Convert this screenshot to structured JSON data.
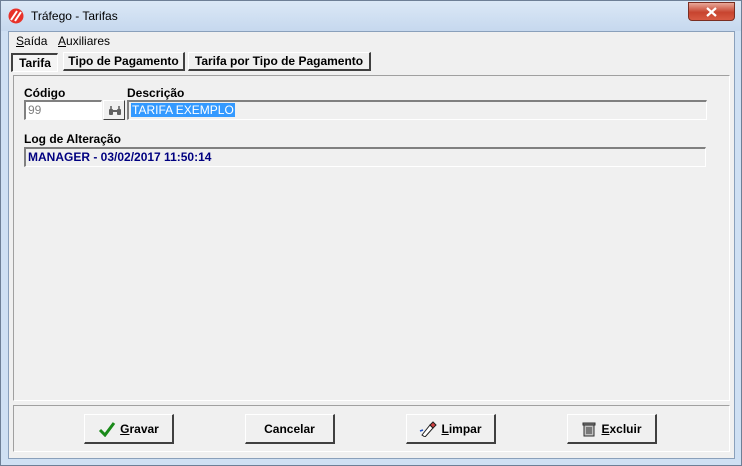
{
  "window": {
    "title": "Tráfego - Tarifas"
  },
  "menu": {
    "items": [
      {
        "first": "S",
        "rest": "aída"
      },
      {
        "first": "A",
        "rest": "uxiliares"
      }
    ]
  },
  "tabs": [
    {
      "label": "Tarifa",
      "active": true
    },
    {
      "label": "Tipo de Pagamento",
      "active": false
    },
    {
      "label": "Tarifa por Tipo de Pagamento",
      "active": false
    }
  ],
  "form": {
    "codigo_label": "Código",
    "codigo_value": "99",
    "descricao_label": "Descrição",
    "descricao_value": "TARIFA EXEMPLO",
    "log_label": "Log de Alteração",
    "log_value": "MANAGER - 03/02/2017 11:50:14"
  },
  "buttons": {
    "gravar": {
      "first": "G",
      "rest": "ravar"
    },
    "cancelar": {
      "label": "Cancelar"
    },
    "limpar": {
      "first": "L",
      "rest": "impar"
    },
    "excluir": {
      "first": "E",
      "rest": "xcluir"
    }
  },
  "colors": {
    "accent_selection": "#3399ff",
    "log_text": "#000080",
    "close_button": "#c7442f"
  },
  "icons": {
    "app": "app-logo-icon",
    "lookup": "binoculars-icon",
    "gravar": "checkmark-icon",
    "limpar": "eraser-brush-icon",
    "excluir": "trash-bin-icon"
  }
}
